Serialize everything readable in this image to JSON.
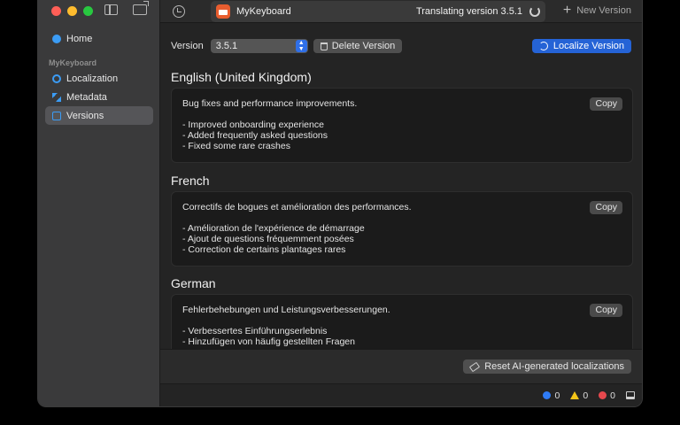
{
  "toolbar": {
    "app_name": "MyKeyboard",
    "status": "Translating version 3.5.1",
    "new_version_label": "New Version"
  },
  "sidebar": {
    "home_label": "Home",
    "section_label": "MyKeyboard",
    "items": [
      {
        "label": "Localization"
      },
      {
        "label": "Metadata"
      },
      {
        "label": "Versions"
      }
    ]
  },
  "main": {
    "version_label": "Version",
    "version_value": "3.5.1",
    "delete_label": "Delete Version",
    "localize_label": "Localize Version",
    "copy_label": "Copy",
    "languages": [
      {
        "name": "English (United Kingdom)",
        "notes": "Bug fixes and performance improvements.\n\n- Improved onboarding experience\n- Added frequently asked questions\n- Fixed some rare crashes"
      },
      {
        "name": "French",
        "notes": "Correctifs de bogues et amélioration des performances.\n\n- Amélioration de l'expérience de démarrage\n- Ajout de questions fréquemment posées\n- Correction de certains plantages rares"
      },
      {
        "name": "German",
        "notes": "Fehlerbehebungen und Leistungsverbesserungen.\n\n- Verbessertes Einführungserlebnis\n- Hinzufügen von häufig gestellten Fragen"
      }
    ],
    "reset_label": "Reset AI-generated localizations"
  },
  "status_bar": {
    "info_count": "0",
    "warning_count": "0",
    "error_count": "0"
  },
  "colors": {
    "accent": "#2563d6",
    "close": "#ff5f57",
    "minimize": "#febc2e",
    "zoom": "#28c840"
  }
}
